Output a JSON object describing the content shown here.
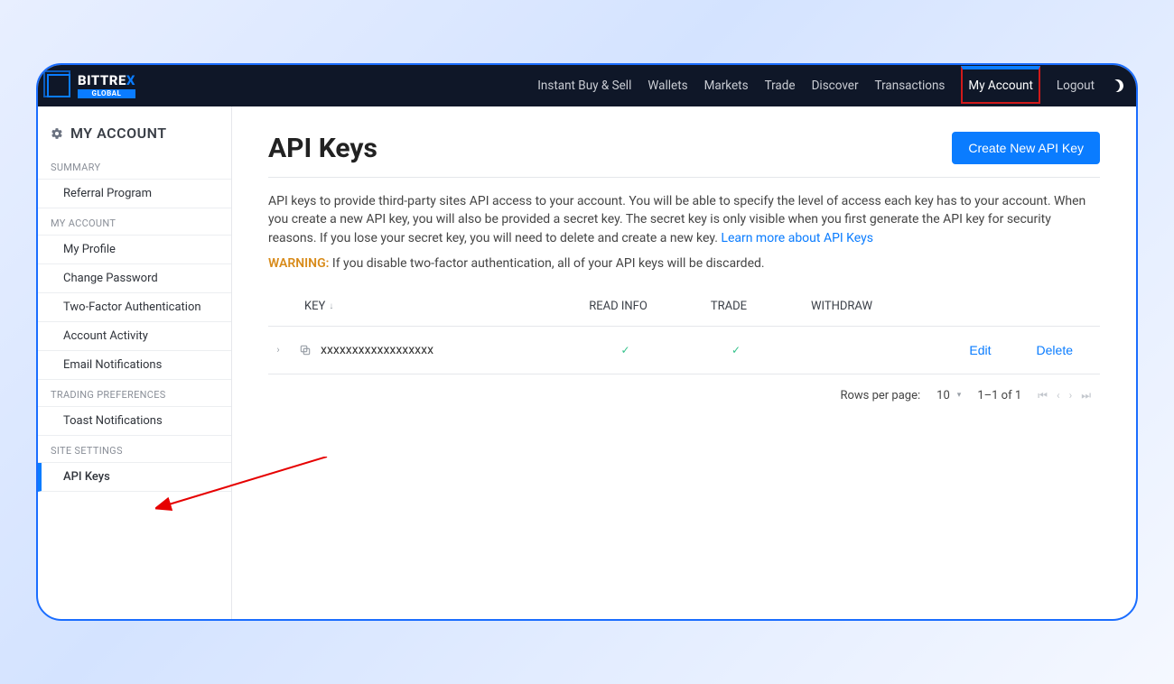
{
  "brand": {
    "name": "BITTREX",
    "badge": "GLOBAL"
  },
  "nav": {
    "items": [
      "Instant Buy & Sell",
      "Wallets",
      "Markets",
      "Trade",
      "Discover",
      "Transactions",
      "My Account",
      "Logout"
    ],
    "active": "My Account"
  },
  "sidebar": {
    "title": "MY ACCOUNT",
    "groups": [
      {
        "label": "SUMMARY",
        "items": [
          "Referral Program"
        ]
      },
      {
        "label": "MY ACCOUNT",
        "items": [
          "My Profile",
          "Change Password",
          "Two-Factor Authentication",
          "Account Activity",
          "Email Notifications"
        ]
      },
      {
        "label": "TRADING PREFERENCES",
        "items": [
          "Toast Notifications"
        ]
      },
      {
        "label": "SITE SETTINGS",
        "items": [
          "API Keys"
        ]
      }
    ],
    "active": "API Keys"
  },
  "page": {
    "title": "API Keys",
    "create_label": "Create New API Key",
    "description": "API keys to provide third-party sites API access to your account. You will be able to specify the level of access each key has to your account. When you create a new API key, you will also be provided a secret key. The secret key is only visible when you first generate the API key for security reasons. If you lose your secret key, you will need to delete and create a new key. ",
    "learn_more": "Learn more about API Keys",
    "warning_label": "WARNING:",
    "warning_text": " If you disable two-factor authentication, all of your API keys will be discarded."
  },
  "table": {
    "columns": {
      "key": "KEY",
      "read": "READ INFO",
      "trade": "TRADE",
      "withdraw": "WITHDRAW"
    },
    "rows": [
      {
        "key": "xxxxxxxxxxxxxxxxxx",
        "read": true,
        "trade": true,
        "withdraw": false
      }
    ],
    "actions": {
      "edit": "Edit",
      "delete": "Delete"
    }
  },
  "pager": {
    "rows_label": "Rows per page:",
    "rows_value": "10",
    "range": "1–1 of 1"
  }
}
